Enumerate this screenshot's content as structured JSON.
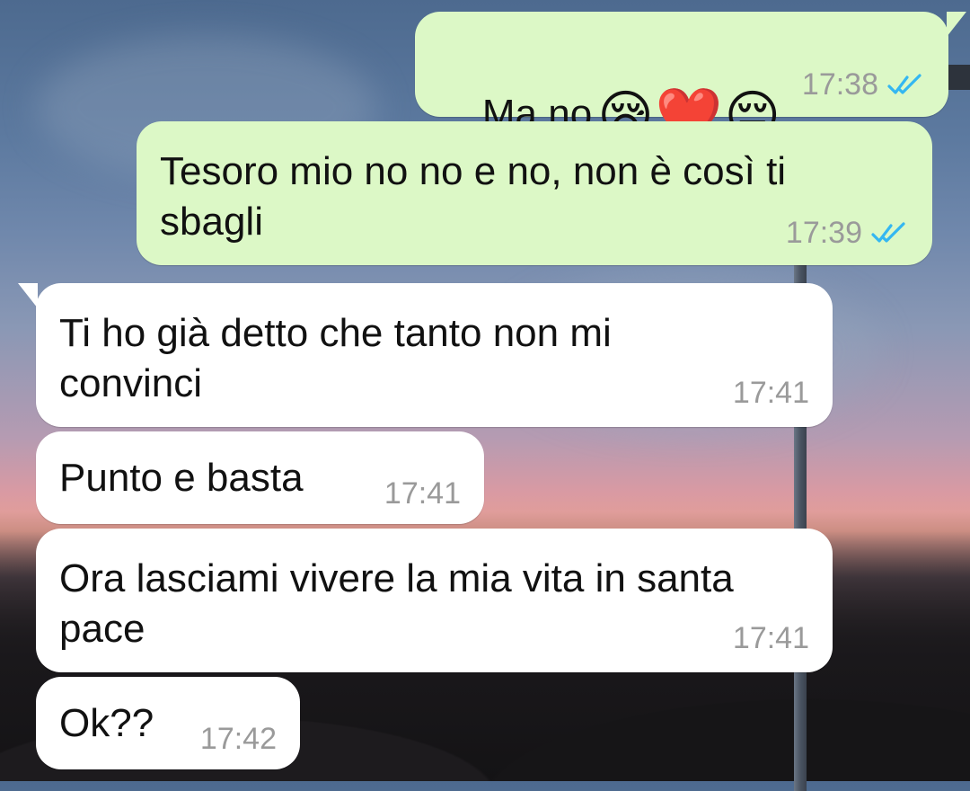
{
  "messages": [
    {
      "text": "Ma no",
      "emojis": [
        "😪",
        "❤️",
        "😔"
      ],
      "time": "17:38",
      "direction": "outgoing",
      "status": "read"
    },
    {
      "text": "Tesoro mio no no e no, non è così ti sbagli",
      "time": "17:39",
      "direction": "outgoing",
      "status": "read"
    },
    {
      "text": "Ti ho già detto che tanto non mi convinci",
      "time": "17:41",
      "direction": "incoming"
    },
    {
      "text": "Punto e basta",
      "time": "17:41",
      "direction": "incoming"
    },
    {
      "text": "Ora lasciami vivere la mia vita in santa pace",
      "time": "17:41",
      "direction": "incoming"
    },
    {
      "text": "Ok??",
      "time": "17:42",
      "direction": "incoming"
    }
  ],
  "colors": {
    "outgoing_bubble": "#dcf8c6",
    "incoming_bubble": "#ffffff",
    "read_ticks": "#34b7f1",
    "timestamp": "#9a9a9a"
  },
  "icons": {
    "read_receipt": "double-check-icon"
  }
}
